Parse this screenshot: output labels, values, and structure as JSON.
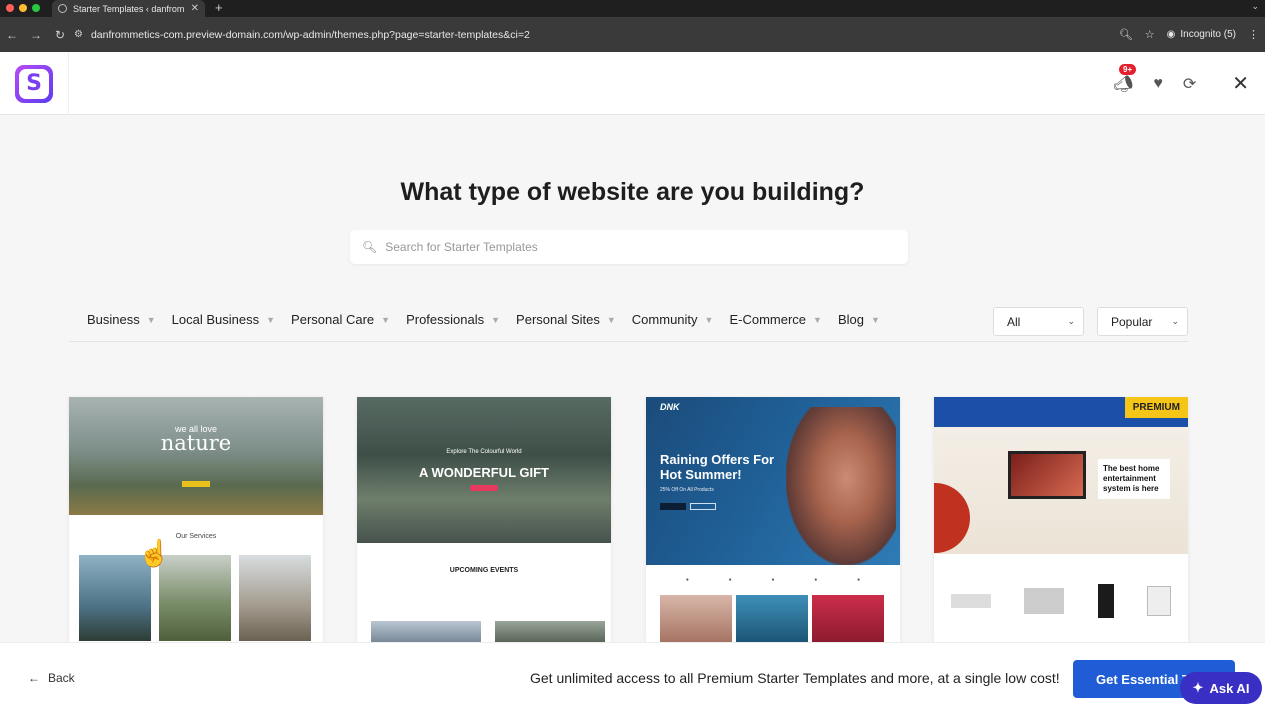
{
  "browser": {
    "tab_title": "Starter Templates ‹ danfromm",
    "url": "danfrommetics-com.preview-domain.com/wp-admin/themes.php?page=starter-templates&ci=2",
    "incognito_label": "Incognito (5)"
  },
  "header": {
    "logo_letter": "S",
    "notification_badge": "9+"
  },
  "main": {
    "heading": "What type of website are you building?",
    "search_placeholder": "Search for Starter Templates",
    "categories": [
      "Business",
      "Local Business",
      "Personal Care",
      "Professionals",
      "Personal Sites",
      "Community",
      "E-Commerce",
      "Blog"
    ],
    "filter_type": "All",
    "filter_sort": "Popular"
  },
  "cards": [
    {
      "hero_small": "we all love",
      "hero_big": "nature",
      "section": "Our Services"
    },
    {
      "hero_small": "Explore The Colourful World",
      "hero_big": "A WONDERFUL GIFT",
      "section": "UPCOMING EVENTS"
    },
    {
      "logo": "DNK",
      "hero_big": "Raining Offers For Hot Summer!",
      "hero_sub": "25% Off On All Products"
    },
    {
      "badge": "PREMIUM",
      "hero_text": "The best home entertainment system is here"
    }
  ],
  "footer": {
    "back_label": "Back",
    "promo_text": "Get unlimited access to all Premium Starter Templates and more, at a single low cost!",
    "cta_label": "Get Essential To",
    "ask_ai_label": "Ask AI"
  },
  "colors": {
    "accent": "#1f5cd6",
    "ask_ai": "#3a2fc4",
    "premium": "#f5c518",
    "badge": "#e5202e"
  }
}
